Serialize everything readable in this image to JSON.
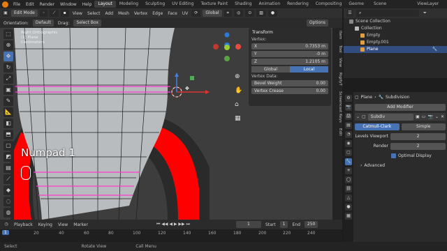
{
  "topbar": {
    "menus": [
      "File",
      "Edit",
      "Render",
      "Window",
      "Help"
    ],
    "workspaces": [
      "Layout",
      "Modeling",
      "Sculpting",
      "UV Editing",
      "Texture Paint",
      "Shading",
      "Animation",
      "Rendering",
      "Compositing",
      "Geome"
    ],
    "active_workspace": "Layout",
    "scene": "Scene",
    "view_layer": "ViewLayer"
  },
  "viewport_header": {
    "mode": "Edit Mode",
    "menus": [
      "View",
      "Select",
      "Add",
      "Mesh",
      "Vertex",
      "Edge",
      "Face",
      "UV"
    ],
    "transform_orientation": "Global"
  },
  "tool_header": {
    "orientation_label": "Orientation:",
    "orientation_value": "Default",
    "drag_label": "Drag:",
    "drag_value": "Select Box",
    "options": "Options"
  },
  "viewport": {
    "info_text": [
      "Right Orthographic",
      "(1) Plane",
      "Centimeters"
    ],
    "overlay_key": "Numpad 1",
    "gizmo_axes": [
      "Z",
      "Y",
      "X"
    ]
  },
  "npanel": {
    "title": "Transform",
    "vertex_label": "Vertex:",
    "x": {
      "label": "X",
      "value": "0.7353 m"
    },
    "y": {
      "label": "Y",
      "value": "-0 m"
    },
    "z": {
      "label": "Z",
      "value": "1.2105 m"
    },
    "space_global": "Global",
    "space_local": "Local",
    "vertex_data_label": "Vertex Data:",
    "bevel_weight": {
      "label": "Bevel Weight",
      "value": "0.00"
    },
    "vertex_crease": {
      "label": "Vertex Crease",
      "value": "0.00"
    }
  },
  "side_tabs": [
    "Item",
    "Tool",
    "View",
    "RigifyT",
    "Screencast Keys",
    "Edit"
  ],
  "outliner": {
    "rows": [
      {
        "label": "Scene Collection",
        "indent": 0
      },
      {
        "label": "Collection",
        "indent": 1
      },
      {
        "label": "Empty",
        "indent": 2
      },
      {
        "label": "Empty.001",
        "indent": 2
      },
      {
        "label": "Plane",
        "indent": 2,
        "selected": true
      }
    ]
  },
  "properties": {
    "object_name": "Plane",
    "modifier_tab": "Subdivision",
    "add_modifier": "Add Modifier",
    "modifier_name": "Subdiv",
    "catmull": "Catmull-Clark",
    "simple": "Simple",
    "levels_viewport_label": "Levels Viewport",
    "levels_viewport": "2",
    "render_label": "Render",
    "render": "2",
    "optimal_display": "Optimal Display",
    "advanced": "Advanced"
  },
  "timeline": {
    "menus": [
      "Playback",
      "Keying",
      "View",
      "Marker"
    ],
    "current_frame": "1",
    "start_label": "Start",
    "start": "1",
    "end_label": "End",
    "end": "250",
    "ticks": [
      "1",
      "20",
      "40",
      "60",
      "80",
      "100",
      "120",
      "140",
      "160",
      "180",
      "200",
      "220",
      "240"
    ]
  },
  "status_bar": {
    "left": "Select",
    "middle": "Rotate View",
    "right": "Call Menu"
  },
  "colors": {
    "accent": "#4772b3",
    "edge_selected": "#ff3ad0",
    "red_fill": "#ff0000"
  }
}
